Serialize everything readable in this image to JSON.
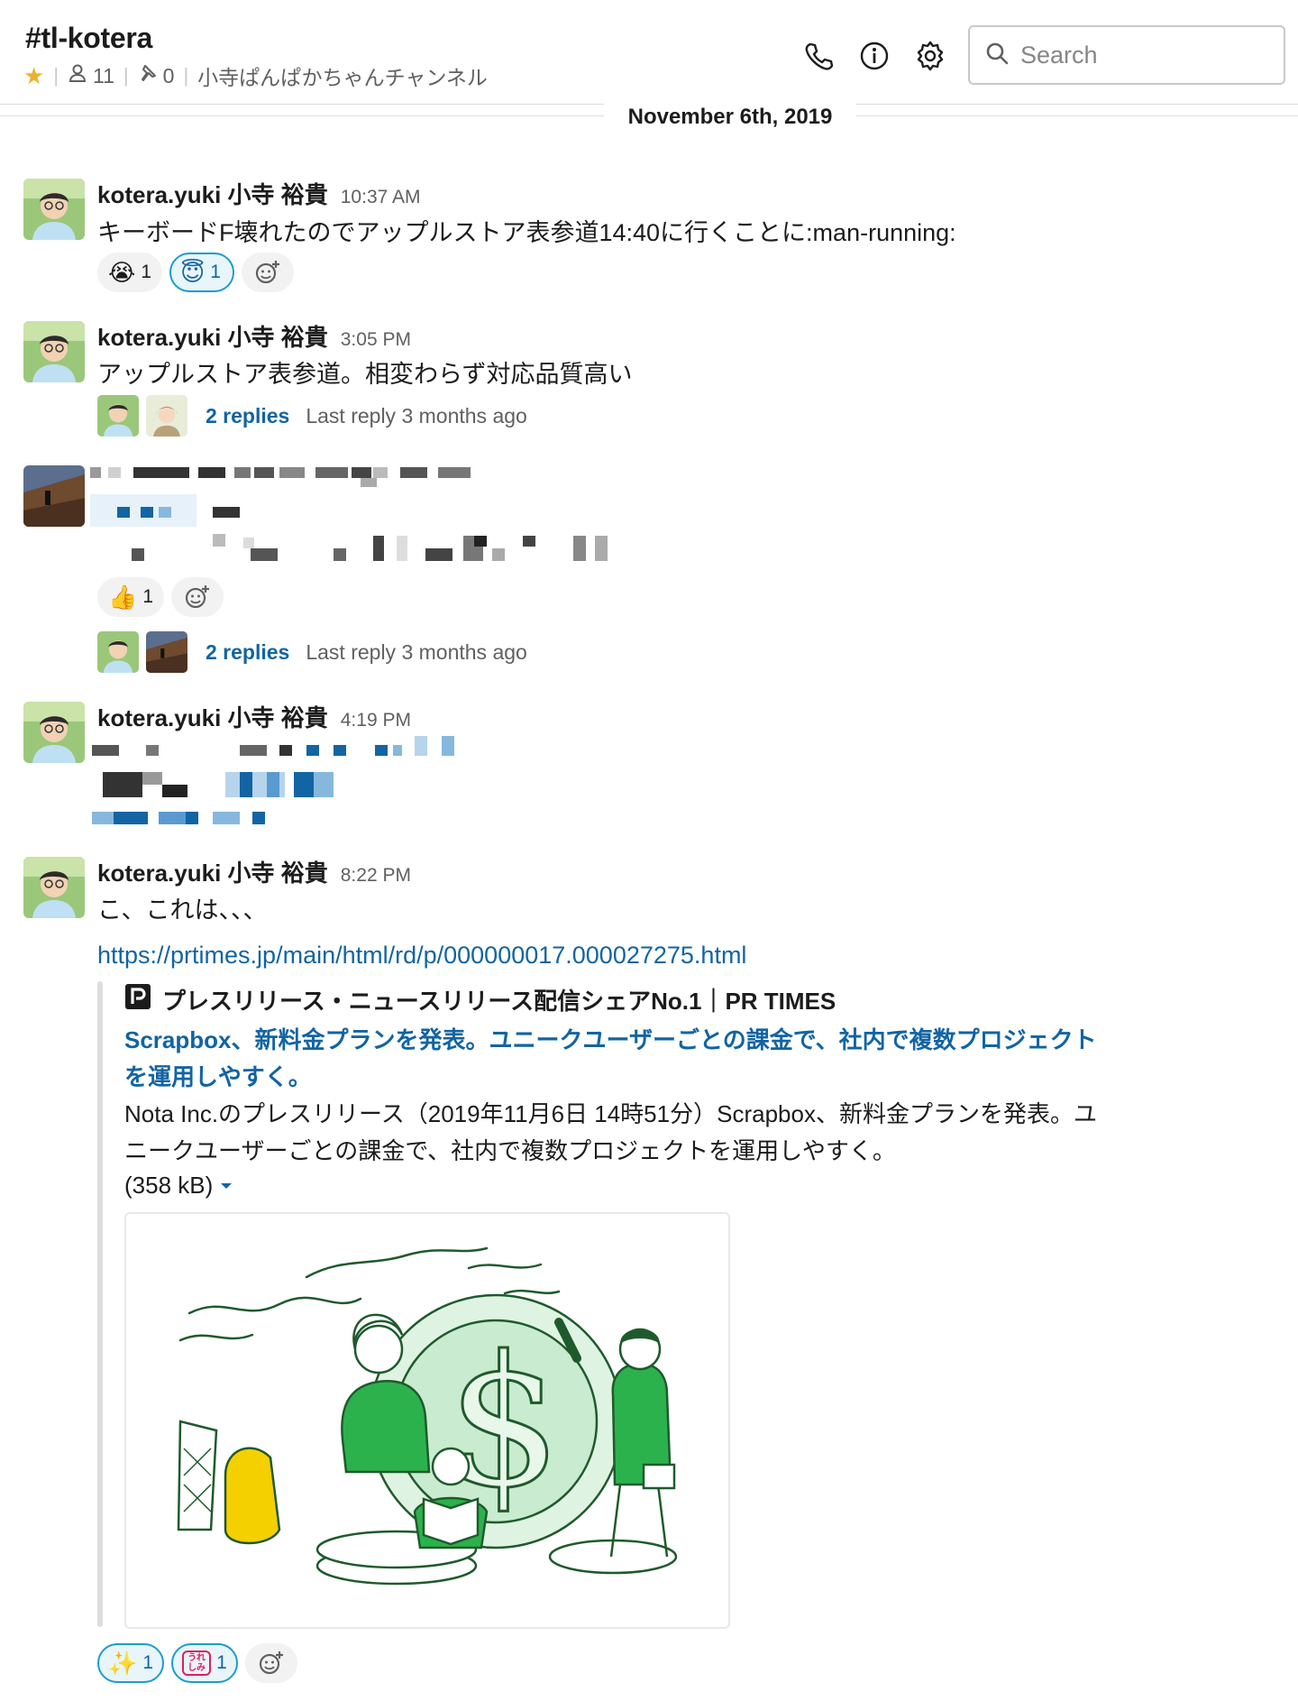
{
  "channel": {
    "name": "#tl-kotera",
    "members": "11",
    "pins": "0",
    "topic": "小寺ぱんぱかちゃんチャンネル"
  },
  "search": {
    "placeholder": "Search"
  },
  "date_divider": "November 6th, 2019",
  "messages": [
    {
      "author": "kotera.yuki 小寺 裕貴",
      "time": "10:37 AM",
      "text": "キーボードF壊れたのでアップルストア表参道14:40に行くことに:man-running:",
      "reactions": [
        {
          "emoji": "😭",
          "count": "1"
        },
        {
          "emoji": "😇",
          "count": "1"
        }
      ]
    },
    {
      "author": "kotera.yuki 小寺 裕貴",
      "time": "3:05 PM",
      "text": "アップルストア表参道。相変わらず対応品質高い",
      "thread": {
        "replies": "2 replies",
        "last": "Last reply 3 months ago"
      }
    },
    {
      "reactions": [
        {
          "emoji": "👍",
          "count": "1"
        }
      ],
      "thread": {
        "replies": "2 replies",
        "last": "Last reply 3 months ago"
      }
    },
    {
      "author": "kotera.yuki 小寺 裕貴",
      "time": "4:19 PM"
    },
    {
      "author": "kotera.yuki 小寺 裕貴",
      "time": "8:22 PM",
      "text": "こ、これは、、、",
      "link": "https://prtimes.jp/main/html/rd/p/000000017.000027275.html",
      "unfurl": {
        "site": "プレスリリース・ニュースリリース配信シェアNo.1｜PR TIMES",
        "title": "Scrapbox、新料金プランを発表。ユニークユーザーごとの課金で、社内で複数プロジェクトを運用しやすく。",
        "description": "Nota Inc.のプレスリリース（2019年11月6日 14時51分）Scrapbox、新料金プランを発表。ユニークユーザーごとの課金で、社内で複数プロジェクトを運用しやすく。",
        "size": "(358 kB)"
      },
      "reactions": [
        {
          "emoji": "✨",
          "count": "1"
        },
        {
          "emoji": "うれしみ",
          "count": "1"
        }
      ]
    }
  ],
  "colors": {
    "link": "#1264a3",
    "accent": "#1d9bd1",
    "illustration_green": "#2bb24c",
    "beaver_yellow": "#f5d000"
  },
  "icons": [
    "star-icon",
    "members-icon",
    "pin-icon",
    "phone-icon",
    "info-icon",
    "gear-icon",
    "search-icon",
    "add-reaction-icon",
    "caret-down-icon",
    "prtimes-logo-icon"
  ]
}
